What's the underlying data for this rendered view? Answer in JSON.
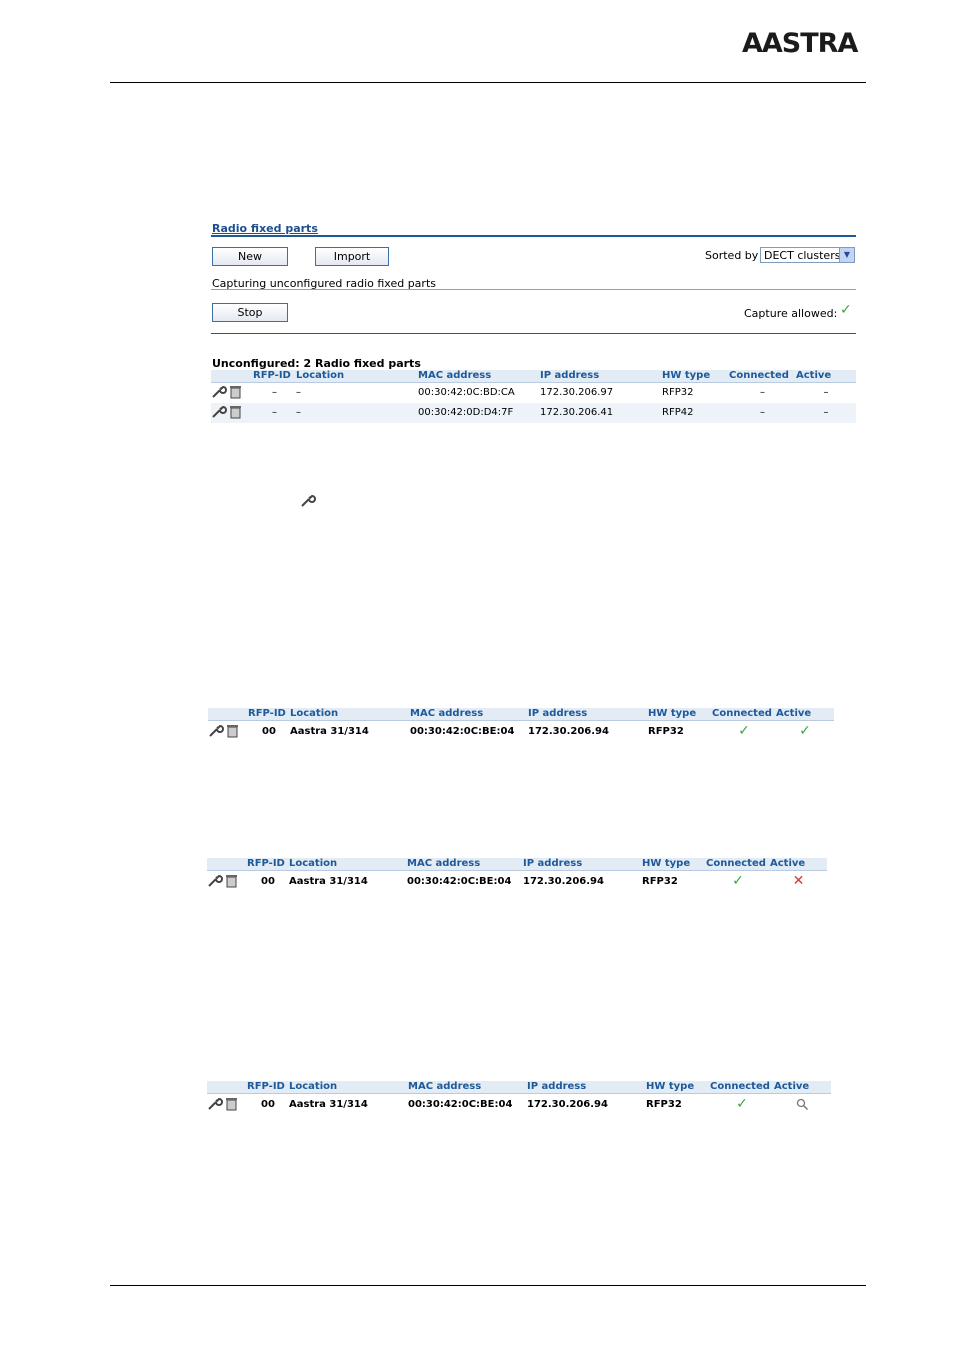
{
  "logo": {
    "text": "AASTRA"
  },
  "panel": {
    "title": "Radio fixed parts",
    "new_label": "New",
    "import_label": "Import",
    "sorted_by_label": "Sorted by",
    "sort_value": "DECT clusters",
    "capture_status": "Capturing unconfigured radio fixed parts",
    "stop_label": "Stop",
    "capture_allowed_label": "Capture allowed:",
    "unconfigured_heading": "Unconfigured: 2 Radio fixed parts"
  },
  "columns": [
    "RFP-ID",
    "Location",
    "MAC address",
    "IP address",
    "HW type",
    "Connected",
    "Active"
  ],
  "unconfigured_rows": [
    {
      "rfp_id": "–",
      "location": "–",
      "mac": "00:30:42:0C:BD:CA",
      "ip": "172.30.206.97",
      "hw": "RFP32",
      "connected": "–",
      "active": "–"
    },
    {
      "rfp_id": "–",
      "location": "–",
      "mac": "00:30:42:0D:D4:7F",
      "ip": "172.30.206.41",
      "hw": "RFP42",
      "connected": "–",
      "active": "–"
    }
  ],
  "example1": {
    "rfp_id": "00",
    "location": "Aastra 31/314",
    "mac": "00:30:42:0C:BE:04",
    "ip": "172.30.206.94",
    "hw": "RFP32",
    "connected": "check",
    "active": "check"
  },
  "example2": {
    "rfp_id": "00",
    "location": "Aastra 31/314",
    "mac": "00:30:42:0C:BE:04",
    "ip": "172.30.206.94",
    "hw": "RFP32",
    "connected": "check",
    "active": "cross"
  },
  "example3": {
    "rfp_id": "00",
    "location": "Aastra 31/314",
    "mac": "00:30:42:0C:BE:04",
    "ip": "172.30.206.94",
    "hw": "RFP32",
    "connected": "check",
    "active": "magnifier"
  },
  "colors": {
    "accent": "#1d5a9a",
    "header_bg": "#e3ebf5",
    "check": "#3aa83a",
    "cross": "#d03a3a"
  }
}
